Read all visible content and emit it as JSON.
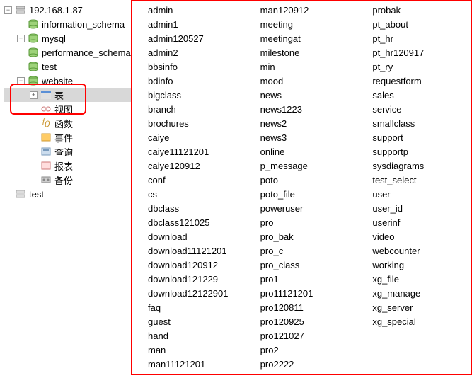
{
  "tree": {
    "root": "192.168.1.87",
    "items": [
      {
        "label": "information_schema",
        "icon": "db",
        "indent": 18,
        "exp": "none"
      },
      {
        "label": "mysql",
        "icon": "db",
        "indent": 18,
        "exp": "plus"
      },
      {
        "label": "performance_schema",
        "icon": "db",
        "indent": 18,
        "exp": "none"
      },
      {
        "label": "test",
        "icon": "db",
        "indent": 18,
        "exp": "none"
      },
      {
        "label": "website",
        "icon": "db",
        "indent": 18,
        "exp": "minus"
      },
      {
        "label": "表",
        "icon": "table",
        "indent": 36,
        "exp": "plus",
        "sel": true
      },
      {
        "label": "视图",
        "icon": "view",
        "indent": 36,
        "exp": "none"
      },
      {
        "label": "函数",
        "icon": "fx",
        "indent": 36,
        "exp": "none"
      },
      {
        "label": "事件",
        "icon": "event",
        "indent": 36,
        "exp": "none"
      },
      {
        "label": "查询",
        "icon": "query",
        "indent": 36,
        "exp": "none"
      },
      {
        "label": "报表",
        "icon": "report",
        "indent": 36,
        "exp": "none"
      },
      {
        "label": "备份",
        "icon": "backup",
        "indent": 36,
        "exp": "none"
      }
    ],
    "footer": {
      "label": "test",
      "icon": "srv",
      "indent": 0,
      "exp": "none"
    }
  },
  "tables": {
    "col1": [
      "admin",
      "admin1",
      "admin120527",
      "admin2",
      "bbsinfo",
      "bdinfo",
      "bigclass",
      "branch",
      "brochures",
      "caiye",
      "caiye11121201",
      "caiye120912",
      "conf",
      "cs",
      "dbclass",
      "dbclass121025",
      "download",
      "download11121201",
      "download120912",
      "download121229",
      "download12122901",
      "faq",
      "guest",
      "hand",
      "man",
      "man11121201"
    ],
    "col2": [
      "man120912",
      "meeting",
      "meetingat",
      "milestone",
      "min",
      "mood",
      "news",
      "news1223",
      "news2",
      "news3",
      "online",
      "p_message",
      "poto",
      "poto_file",
      "poweruser",
      "pro",
      "pro_bak",
      "pro_c",
      "pro_class",
      "pro1",
      "pro11121201",
      "pro120811",
      "pro120925",
      "pro121027",
      "pro2",
      "pro2222"
    ],
    "col3": [
      "probak",
      "pt_about",
      "pt_hr",
      "pt_hr120917",
      "pt_ry",
      "requestform",
      "sales",
      "service",
      "smallclass",
      "support",
      "supportp",
      "sysdiagrams",
      "test_select",
      "user",
      "user_id",
      "userinf",
      "video",
      "webcounter",
      "working",
      "xg_file",
      "xg_manage",
      "xg_server",
      "xg_special"
    ]
  }
}
